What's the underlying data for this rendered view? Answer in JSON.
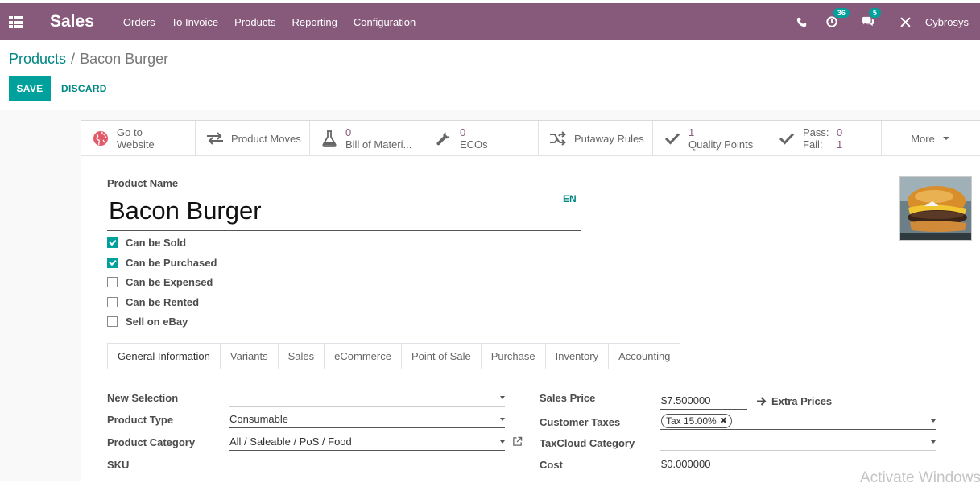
{
  "navbar": {
    "app_name": "Sales",
    "menu": [
      "Orders",
      "To Invoice",
      "Products",
      "Reporting",
      "Configuration"
    ],
    "activity_count": "36",
    "message_count": "5",
    "user_name": "Cybrosys"
  },
  "breadcrumb": {
    "parent": "Products",
    "separator": "/",
    "current": "Bacon Burger"
  },
  "actions": {
    "save": "SAVE",
    "discard": "DISCARD"
  },
  "smart_buttons": {
    "website": {
      "line1": "Go to",
      "line2": "Website"
    },
    "product_moves": {
      "label": "Product Moves"
    },
    "bom": {
      "count": "0",
      "label": "Bill of Materi..."
    },
    "ecos": {
      "count": "0",
      "label": "ECOs"
    },
    "putaway": {
      "label": "Putaway Rules"
    },
    "quality": {
      "count": "1",
      "label": "Quality Points"
    },
    "pass_fail": {
      "pass_label": "Pass:",
      "pass_value": "0",
      "fail_label": "Fail:",
      "fail_value": "1"
    },
    "more": {
      "label": "More"
    }
  },
  "product": {
    "name_label": "Product Name",
    "name": "Bacon Burger",
    "lang": "EN",
    "image_alt": "burger-product-image"
  },
  "checkboxes": [
    {
      "label": "Can be Sold",
      "checked": true
    },
    {
      "label": "Can be Purchased",
      "checked": true
    },
    {
      "label": "Can be Expensed",
      "checked": false
    },
    {
      "label": "Can be Rented",
      "checked": false
    },
    {
      "label": "Sell on eBay",
      "checked": false
    }
  ],
  "tabs": [
    "General Information",
    "Variants",
    "Sales",
    "eCommerce",
    "Point of Sale",
    "Purchase",
    "Inventory",
    "Accounting"
  ],
  "active_tab": "General Information",
  "form": {
    "left": {
      "new_selection_label": "New Selection",
      "new_selection_value": "",
      "product_type_label": "Product Type",
      "product_type_value": "Consumable",
      "product_category_label": "Product Category",
      "product_category_value": "All / Saleable / PoS / Food",
      "sku_label": "SKU",
      "sku_value": ""
    },
    "right": {
      "sales_price_label": "Sales Price",
      "sales_price_value": "$7.500000",
      "extra_prices": "Extra Prices",
      "customer_taxes_label": "Customer Taxes",
      "customer_tax_tag": "Tax 15.00%",
      "taxcloud_label": "TaxCloud Category",
      "taxcloud_value": "",
      "cost_label": "Cost",
      "cost_value": "$0.000000"
    }
  },
  "watermark": "Activate Windows",
  "colors": {
    "brand": "#875a7b",
    "accent": "#00a09d",
    "link": "#008784"
  }
}
